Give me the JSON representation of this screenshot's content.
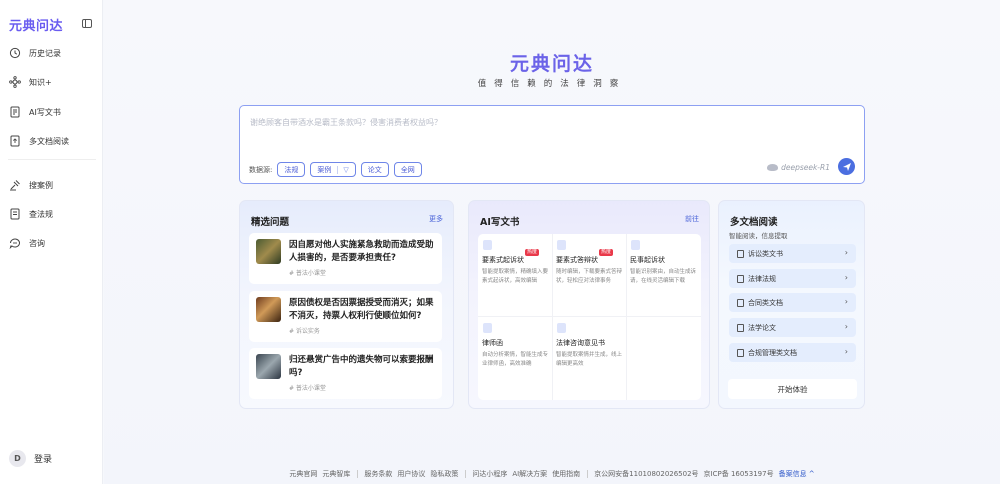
{
  "sidebar": {
    "logo": "元典问达",
    "items": [
      {
        "label": "历史记录",
        "icon": "history-icon"
      },
      {
        "label": "知识+",
        "icon": "knowledge-icon"
      },
      {
        "label": "AI写文书",
        "icon": "ai-doc-icon"
      },
      {
        "label": "多文档阅读",
        "icon": "multi-doc-icon"
      },
      {
        "label": "搜案例",
        "icon": "case-search-icon"
      },
      {
        "label": "查法规",
        "icon": "law-lookup-icon"
      },
      {
        "label": "咨询",
        "icon": "consult-icon"
      }
    ],
    "login_label": "登录",
    "login_avatar": "D"
  },
  "hero": {
    "brand": "元典问达",
    "tagline": "值得信赖的法律洞察"
  },
  "search": {
    "placeholder": "谢绝顾客自带酒水是霸王条款吗？侵害消费者权益吗？",
    "source_label": "数据源:",
    "chips": [
      "法规",
      "案例",
      "论文",
      "全网"
    ],
    "filter_symbol": "▽",
    "model": "deepseek-R1"
  },
  "featured": {
    "title": "精选问题",
    "more": "更多",
    "items": [
      {
        "question": "因自愿对他人实施紧急救助而造成受助人损害的，是否要承担责任?",
        "tag": "# 普法小课堂"
      },
      {
        "question": "原因债权是否因票据授受而消灭；如果不消灭，持票人权利行使顺位如何?",
        "tag": "# 诉讼实务"
      },
      {
        "question": "归还悬赏广告中的遗失物可以索要报酬吗?",
        "tag": "# 普法小课堂"
      }
    ]
  },
  "ai_doc": {
    "title": "AI写文书",
    "go": "前往",
    "items": [
      {
        "name": "要素式起诉状",
        "desc": "智能提取案情，精确填入要素式起诉状，高效编辑",
        "hot": "热度"
      },
      {
        "name": "要素式答辩状",
        "desc": "随时编辑，下载要素式答辩状，轻松应对法律事务",
        "hot": "热度"
      },
      {
        "name": "民事起诉状",
        "desc": "智能识别案由，自动生成诉请，在线灵活编辑下载",
        "hot": ""
      },
      {
        "name": "律师函",
        "desc": "自动分析案情，智能生成专业律师函，高效准确",
        "hot": ""
      },
      {
        "name": "法律咨询意见书",
        "desc": "智能提取案情并生成，线上编辑更高效",
        "hot": ""
      }
    ]
  },
  "multi_doc": {
    "title": "多文档阅读",
    "subtitle": "智能阅读，信息提取",
    "items": [
      "诉讼类文书",
      "法律法规",
      "合同类文档",
      "法学论文",
      "合规管理类文档"
    ],
    "try_label": "开始体验"
  },
  "footer": {
    "groups": [
      [
        "元典官网",
        "元典智库"
      ],
      [
        "服务条款",
        "用户协议",
        "隐私政策"
      ],
      [
        "问达小程序",
        "AI解决方案",
        "使用指南"
      ],
      [
        "京公网安备11010802026502号",
        "京ICP备 16053197号"
      ]
    ],
    "record_info": "备案信息 ^"
  },
  "colors": {
    "accent": "#4b6ee0",
    "brand": "#6b63e8",
    "hot": "#e9394a"
  }
}
